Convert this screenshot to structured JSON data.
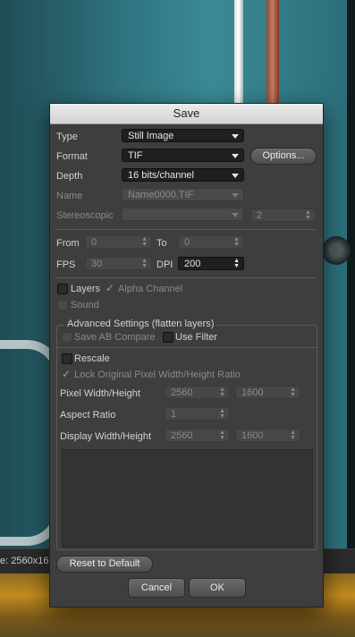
{
  "window_title": "Save",
  "status_bar_text": "e: 2560x16",
  "type": {
    "label": "Type",
    "value": "Still Image"
  },
  "format": {
    "label": "Format",
    "value": "TIF",
    "options_button": "Options..."
  },
  "depth": {
    "label": "Depth",
    "value": "16 bits/channel"
  },
  "name": {
    "label": "Name",
    "value": "Name0000.TIF"
  },
  "stereoscopic": {
    "label": "Stereoscopic",
    "value": "",
    "count": "2"
  },
  "range": {
    "from_label": "From",
    "from_value": "0",
    "to_label": "To",
    "to_value": "0"
  },
  "fps": {
    "label": "FPS",
    "value": "30"
  },
  "dpi": {
    "label": "DPI",
    "value": "200"
  },
  "layers_label": "Layers",
  "alpha_label": "Alpha Channel",
  "sound_label": "Sound",
  "advanced": {
    "title": "Advanced Settings (flatten layers)",
    "save_ab_label": "Save AB Compare",
    "use_filter_label": "Use Filter",
    "rescale_label": "Rescale",
    "lock_ratio_label": "Lock Original Pixel Width/Height Ratio",
    "pixel_wh_label": "Pixel Width/Height",
    "pixel_w": "2560",
    "pixel_h": "1600",
    "aspect_label": "Aspect Ratio",
    "aspect_value": "1",
    "display_wh_label": "Display Width/Height",
    "display_w": "2560",
    "display_h": "1600"
  },
  "buttons": {
    "reset": "Reset to Default",
    "cancel": "Cancel",
    "ok": "OK"
  }
}
